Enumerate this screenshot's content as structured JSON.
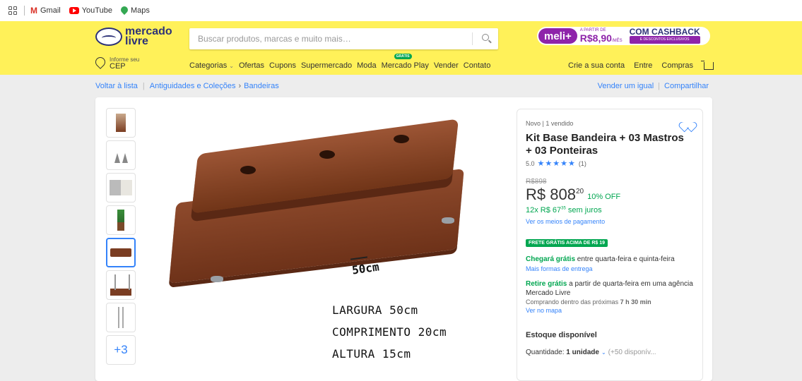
{
  "bookmarks": [
    {
      "label": "Gmail",
      "icon": "gmail-icon"
    },
    {
      "label": "YouTube",
      "icon": "youtube-icon"
    },
    {
      "label": "Maps",
      "icon": "maps-icon"
    }
  ],
  "header": {
    "logo_line1": "mercado",
    "logo_line2": "livre",
    "search_placeholder": "Buscar produtos, marcas e muito mais…",
    "promo": {
      "meli_label": "meli+",
      "price_prefix": "A PARTIR DE",
      "price": "R$8,90",
      "price_suffix": "/MÊS",
      "cashback": "COM CASHBACK",
      "cashback_sub": "E DESCONTOS EXCLUSIVOS"
    },
    "cep_small": "Informe seu",
    "cep_label": "CEP",
    "nav": [
      {
        "label": "Categorias",
        "chevron": "⌄"
      },
      {
        "label": "Ofertas"
      },
      {
        "label": "Cupons"
      },
      {
        "label": "Supermercado"
      },
      {
        "label": "Moda"
      },
      {
        "label": "Mercado Play",
        "badge": "GRÁTIS"
      },
      {
        "label": "Vender"
      },
      {
        "label": "Contato"
      }
    ],
    "account": {
      "create": "Crie a sua conta",
      "login": "Entre",
      "purchases": "Compras"
    }
  },
  "breadcrumb": {
    "back": "Voltar à lista",
    "cat1": "Antiguidades e Coleções",
    "cat2": "Bandeiras",
    "sell_same": "Vender um igual",
    "share": "Compartilhar"
  },
  "gallery": {
    "more_label": "+3",
    "dimension_mark": "50cm",
    "spec_width": "LARGURA 50cm",
    "spec_length": "COMPRIMENTO 20cm",
    "spec_height": "ALTURA 15cm"
  },
  "product": {
    "condition": "Novo",
    "sold": "1 vendido",
    "title": "Kit Base Bandeira + 03 Mastros + 03 Ponteiras",
    "rating_value": "5.0",
    "stars": "★★★★★",
    "review_count": "(1)",
    "old_price": "R$898",
    "price_main": "R$ 808",
    "price_cents": "20",
    "discount": "10% OFF",
    "installments_prefix": "12x R$ 67",
    "installments_cents": "35",
    "installments_suffix": " sem juros",
    "payment_link": "Ver os meios de pagamento",
    "free_shipping_badge": "FRETE GRÁTIS ACIMA DE R$ 19",
    "arrival_bold": "Chegará grátis",
    "arrival_text": " entre quarta-feira e quinta-feira",
    "more_delivery": "Mais formas de entrega",
    "pickup_bold": "Retire grátis",
    "pickup_text": " a partir de quarta-feira em uma agência Mercado Livre",
    "pickup_window": "Comprando dentro das próximas ",
    "pickup_window_bold": "7 h 30 min",
    "map_link": "Ver no mapa",
    "stock": "Estoque disponível",
    "qty_label": "Quantidade: ",
    "qty_value": "1 unidade",
    "qty_available": "(+50 disponív..."
  },
  "colors": {
    "header_yellow": "#fff159",
    "link_blue": "#3483fa",
    "green": "#00a650",
    "meli_purple": "#8e24aa"
  }
}
